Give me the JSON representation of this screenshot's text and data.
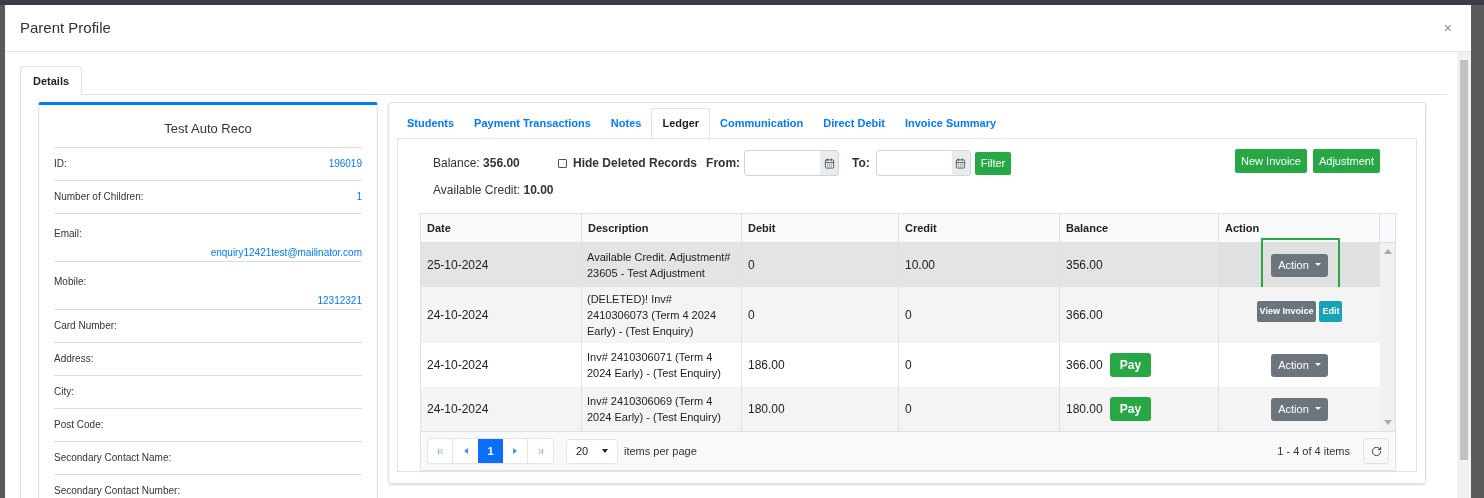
{
  "window": {
    "title": "Parent Profile",
    "close": "×"
  },
  "outer_tabs": [
    {
      "label": "Details",
      "selected": true
    }
  ],
  "profile": {
    "name": "Test Auto Reco",
    "fields": [
      {
        "label": "ID:",
        "value": "196019",
        "stacked": false
      },
      {
        "label": "Number of Children:",
        "value": "1",
        "stacked": false
      },
      {
        "label": "Email:",
        "value": "enquiry12421test@mailinator.com",
        "stacked": true
      },
      {
        "label": "Mobile:",
        "value": "12312321",
        "stacked": true
      },
      {
        "label": "Card Number:"
      },
      {
        "label": "Address:"
      },
      {
        "label": "City:"
      },
      {
        "label": "Post Code:"
      },
      {
        "label": "Secondary Contact Name:"
      },
      {
        "label": "Secondary Contact Number:"
      }
    ]
  },
  "tabs": [
    {
      "label": "Students",
      "selected": false
    },
    {
      "label": "Payment Transactions",
      "selected": false
    },
    {
      "label": "Notes",
      "selected": false
    },
    {
      "label": "Ledger",
      "selected": true
    },
    {
      "label": "Communication",
      "selected": false
    },
    {
      "label": "Direct Debit",
      "selected": false
    },
    {
      "label": "Invoice Summary",
      "selected": false
    }
  ],
  "ledger": {
    "balance_label": "Balance:",
    "balance": "356.00",
    "credit_label": "Available Credit:",
    "credit": "10.00",
    "hide_deleted": {
      "label": "Hide Deleted Records",
      "checked": false
    },
    "from_label": "From:",
    "to_label": "To:",
    "filter_button": "Filter",
    "buttons": [
      "New Invoice",
      "Adjustment"
    ],
    "table": {
      "columns": [
        "Date",
        "Description",
        "Debit",
        "Credit",
        "Balance",
        "Action"
      ],
      "rows": [
        {
          "date": "25-10-2024",
          "description": "Available Credit. Adjustment# 23605 - Test Adjustment",
          "debit": "0",
          "credit": "10.00",
          "balance": "356.00",
          "highlighted": true,
          "action": {
            "kind": "dropdown",
            "labels": [
              "Action"
            ],
            "focused": true
          }
        },
        {
          "date": "24-10-2024",
          "description": "(DELETED)! Inv# 2410306073 (Term 4 2024 Early) - (Test Enquiry)",
          "debit": "0",
          "credit": "0",
          "balance": "366.00",
          "highlighted": false,
          "action": {
            "kind": "buttons",
            "labels": [
              "View Invoice",
              "Edit"
            ],
            "focused": false
          }
        },
        {
          "date": "24-10-2024",
          "description": "Inv# 2410306071 (Term 4 2024 Early) - (Test Enquiry)",
          "debit": "186.00",
          "credit": "0",
          "balance": "366.00",
          "pay": "Pay",
          "highlighted": false,
          "action": {
            "kind": "dropdown",
            "labels": [
              "Action"
            ],
            "focused": false
          }
        },
        {
          "date": "24-10-2024",
          "description": "Inv# 2410306069 (Term 4 2024 Early) - (Test Enquiry)",
          "debit": "180.00",
          "credit": "0",
          "balance": "180.00",
          "pay": "Pay",
          "highlighted": false,
          "action": {
            "kind": "dropdown",
            "labels": [
              "Action"
            ],
            "focused": false
          }
        }
      ]
    },
    "pager": {
      "pages": [
        {
          "label": "1",
          "selected": true
        }
      ],
      "page_size": "20",
      "page_size_label": "items per page",
      "summary": "1 - 4 of 4 items"
    }
  }
}
